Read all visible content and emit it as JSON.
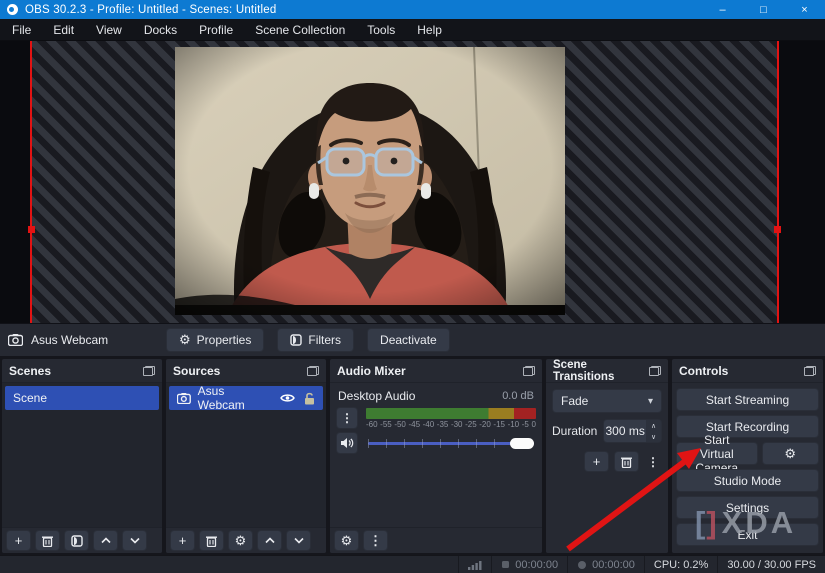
{
  "window": {
    "title": "OBS 30.2.3 - Profile: Untitled - Scenes: Untitled",
    "minimize": "–",
    "maximize": "□",
    "close": "×"
  },
  "menu": {
    "items": [
      "File",
      "Edit",
      "View",
      "Docks",
      "Profile",
      "Scene Collection",
      "Tools",
      "Help"
    ]
  },
  "source_toolbar": {
    "source_label": "Asus Webcam",
    "properties": "Properties",
    "filters": "Filters",
    "deactivate": "Deactivate"
  },
  "scenes": {
    "title": "Scenes",
    "items": [
      "Scene"
    ]
  },
  "sources": {
    "title": "Sources",
    "items": [
      "Asus Webcam"
    ]
  },
  "audio_mixer": {
    "title": "Audio Mixer",
    "channel": "Desktop Audio",
    "level_db": "0.0 dB",
    "ticks": [
      "-60",
      "-55",
      "-50",
      "-45",
      "-40",
      "-35",
      "-30",
      "-25",
      "-20",
      "-15",
      "-10",
      "-5",
      "0"
    ]
  },
  "scene_transitions": {
    "title": "Scene Transitions",
    "transition": "Fade",
    "duration_label": "Duration",
    "duration_value": "300 ms"
  },
  "controls_panel": {
    "title": "Controls",
    "start_streaming": "Start Streaming",
    "start_recording": "Start Recording",
    "start_virtual_camera": "Start Virtual Camera",
    "studio_mode": "Studio Mode",
    "settings": "Settings",
    "exit": "Exit"
  },
  "status_bar": {
    "rec_time": "00:00:00",
    "stream_time": "00:00:00",
    "cpu": "CPU: 0.2%",
    "fps": "30.00 / 30.00 FPS"
  },
  "watermark": {
    "bracket_left": "[",
    "bracket_right": "]",
    "text": "XDA"
  },
  "icons": {
    "gear": "⚙",
    "kebab": "⋮",
    "dropdown_arrow": "▾",
    "plus": "+",
    "spin_up": "∧",
    "spin_down": "∨",
    "stream_dot": "●"
  },
  "colors": {
    "titlebar": "#0d7ad2",
    "selection_blue": "#2e50b4",
    "source_outline_red": "#e21313",
    "meter_green": "#3e7c31",
    "meter_yellow": "#9a7d20",
    "meter_red": "#a32222"
  }
}
